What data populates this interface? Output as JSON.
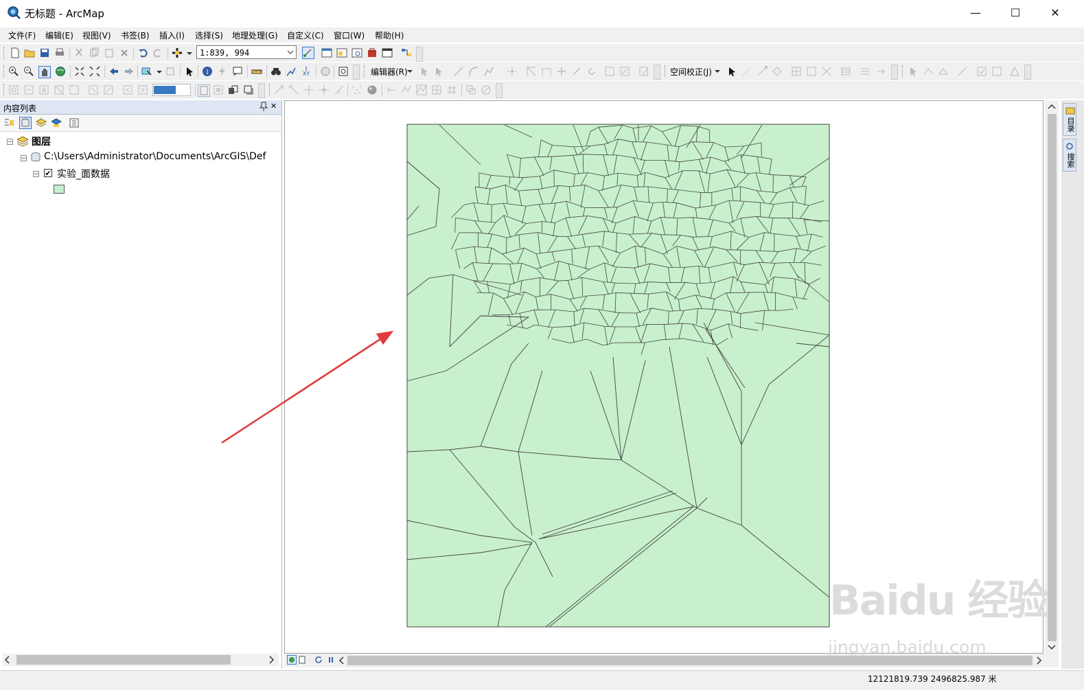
{
  "window": {
    "title": "无标题 - ArcMap",
    "minimize_glyph": "—",
    "maximize_glyph": "☐",
    "close_glyph": "✕"
  },
  "menu": [
    {
      "label": "文件(F)"
    },
    {
      "label": "编辑(E)"
    },
    {
      "label": "视图(V)"
    },
    {
      "label": "书签(B)"
    },
    {
      "label": "插入(I)"
    },
    {
      "label": "选择(S)"
    },
    {
      "label": "地理处理(G)"
    },
    {
      "label": "自定义(C)"
    },
    {
      "label": "窗口(W)"
    },
    {
      "label": "帮助(H)"
    }
  ],
  "toolbar": {
    "scale_value": "1:839, 994",
    "editor_label": "编辑器(R)",
    "spatial_adjust_label": "空间校正(J)"
  },
  "toc": {
    "title": "内容列表",
    "pin_glyph": "ᵖ",
    "close_glyph": "✕",
    "layers_root": "图层",
    "path": "C:\\Users\\Administrator\\Documents\\ArcGIS\\Def",
    "layer_name": "实验_面数据",
    "layer_checked": true,
    "layer_symbol_color": "#c6efce"
  },
  "map": {
    "polygon_fill": "#c8f0cc",
    "line_color": "#444444",
    "arrow_color": "#e03a3a"
  },
  "dock_tabs": [
    {
      "label": "目录"
    },
    {
      "label": "搜索"
    }
  ],
  "status": {
    "coordinates": "12121819.739  2496825.987 米"
  },
  "watermark": {
    "logo": "Baidu 经验",
    "url": "jingyan.baidu.com"
  }
}
